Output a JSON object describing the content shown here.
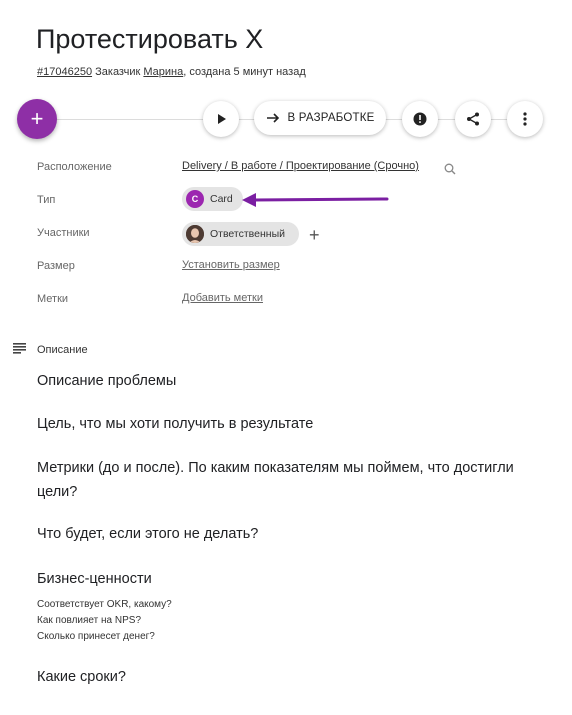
{
  "header": {
    "title": "Протестировать X",
    "task_id": "#17046250",
    "customer_prefix": "Заказчик",
    "customer_name": "Марина",
    "created": ", создана 5 минут назад"
  },
  "toolbar": {
    "status_button": "В РАЗРАБОТКЕ"
  },
  "fields": {
    "location_label": "Расположение",
    "location_value": "Delivery / В работе / Проектирование (Срочно)",
    "type_label": "Тип",
    "type_value": "Card",
    "type_badge": "C",
    "members_label": "Участники",
    "members_value": "Ответственный",
    "size_label": "Размер",
    "size_value": "Установить размер",
    "tags_label": "Метки",
    "tags_value": "Добавить метки"
  },
  "description": {
    "label": "Описание",
    "h1": "Описание проблемы",
    "h2": "Цель, что мы хоти получить в результате",
    "h3": "Метрики (до и после). По каким показателям мы поймем, что достигли цели?",
    "h4": "Что будет, если этого не делать?",
    "h5": "Бизнес-ценности",
    "q1": "Соответствует OKR, какому?",
    "q2": "Как повлияет на NPS?",
    "q3": "Сколько принесет денег?",
    "h6": "Какие сроки?"
  },
  "colors": {
    "accent": "#8e2fa6",
    "arrow": "#7b1fa2",
    "badge": "#9c27b0"
  }
}
